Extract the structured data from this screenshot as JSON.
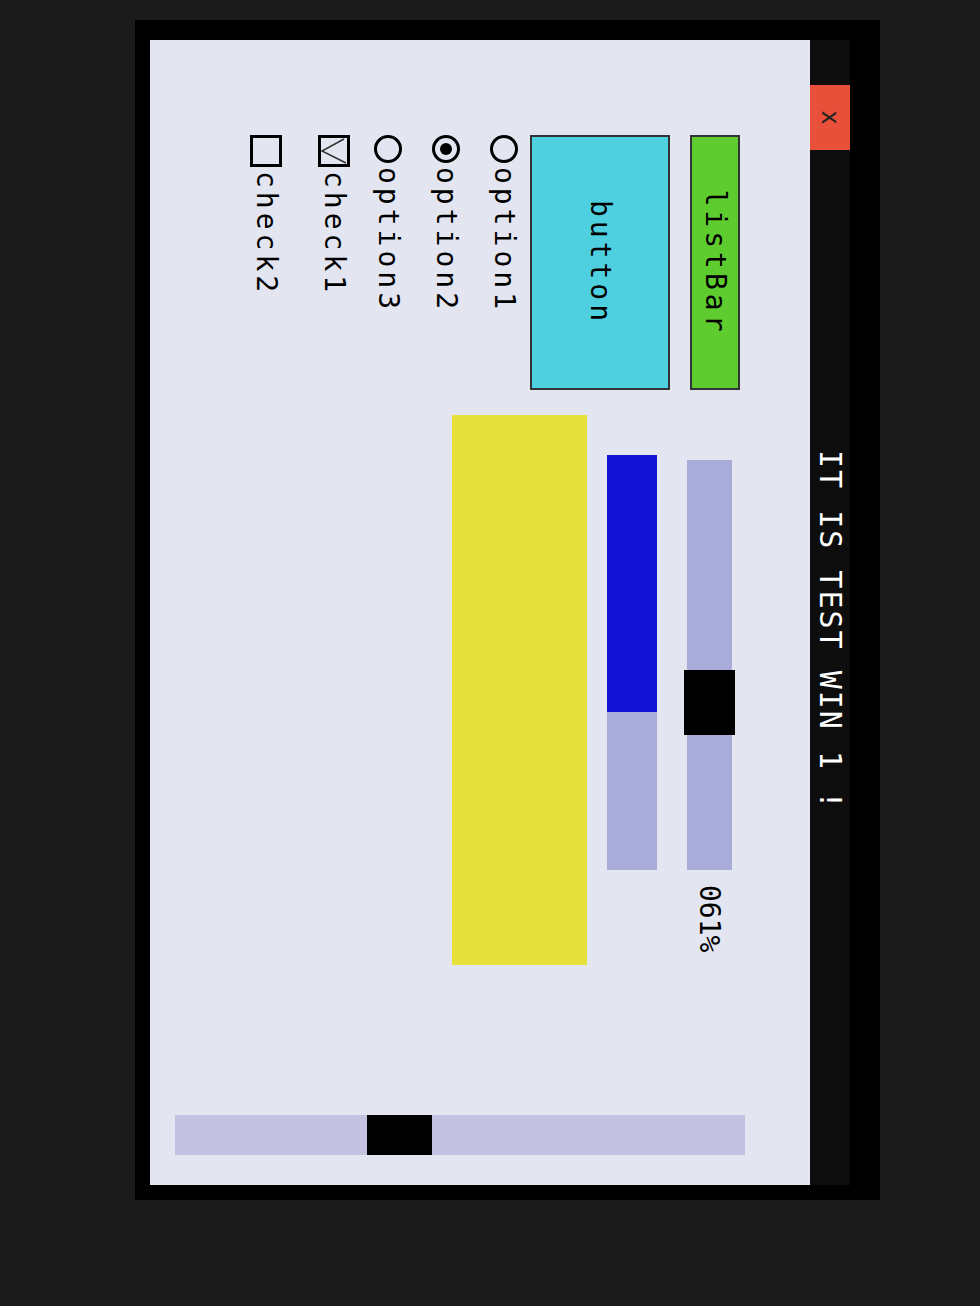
{
  "window": {
    "title": "IT IS TEST WIN 1 !",
    "close": "x"
  },
  "list_bar": {
    "label": "listBar"
  },
  "button": {
    "label": "button"
  },
  "slider": {
    "level": 0.61,
    "reading": "061%"
  },
  "progress": {
    "level": 0.62
  },
  "vertical_slider": {
    "level": 0.62
  },
  "radios": [
    {
      "label": "option1",
      "selected": false
    },
    {
      "label": "option2",
      "selected": true
    },
    {
      "label": "option3",
      "selected": false
    }
  ],
  "checkboxes": [
    {
      "label": "check1",
      "checked": true
    },
    {
      "label": "check2",
      "checked": false
    }
  ]
}
